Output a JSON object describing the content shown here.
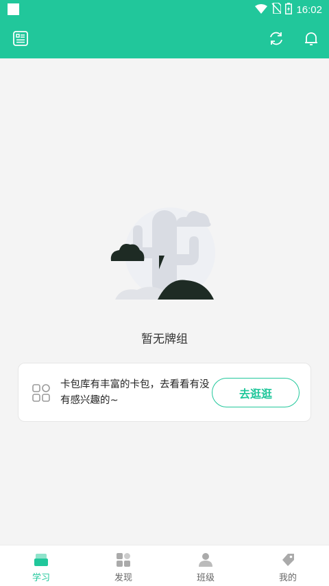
{
  "status_bar": {
    "time": "16:02",
    "icons": [
      "wifi-icon",
      "no-sim-icon",
      "battery-charging-icon"
    ]
  },
  "header": {
    "left_icon": "card-list-icon",
    "right_icons": [
      "refresh-icon",
      "bell-icon"
    ]
  },
  "colors": {
    "accent": "#21c79b",
    "background": "#f4f4f4",
    "inactive": "#999999"
  },
  "empty_state": {
    "illustration": "cactus-illustration",
    "message": "暂无牌组"
  },
  "promo_card": {
    "icon": "grid-apps-icon",
    "text": "卡包库有丰富的卡包，去看看有没有感兴趣的~",
    "button_label": "去逛逛"
  },
  "bottom_nav": {
    "items": [
      {
        "label": "学习",
        "icon": "study-icon",
        "active": true
      },
      {
        "label": "发现",
        "icon": "discover-icon",
        "active": false
      },
      {
        "label": "班级",
        "icon": "class-icon",
        "active": false
      },
      {
        "label": "我的",
        "icon": "profile-icon",
        "active": false
      }
    ]
  }
}
